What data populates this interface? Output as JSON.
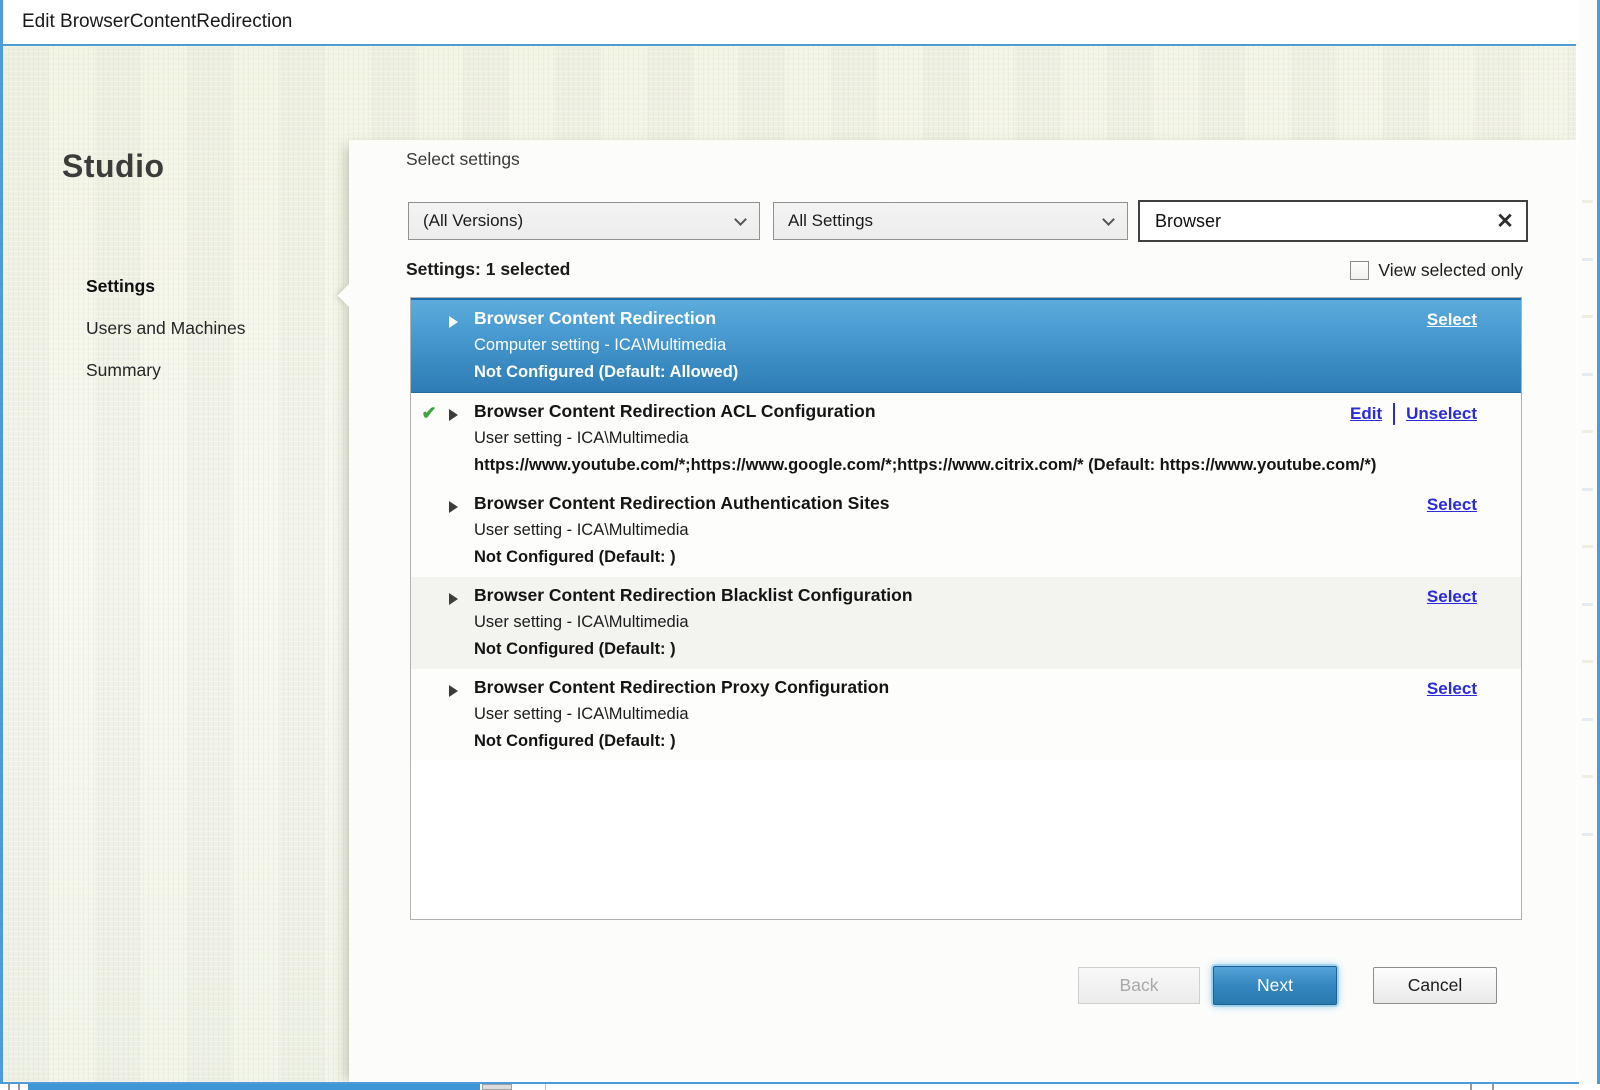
{
  "window": {
    "title": "Edit BrowserContentRedirection"
  },
  "sidebar": {
    "brand": "Studio",
    "items": [
      {
        "label": "Settings",
        "active": true
      },
      {
        "label": "Users and Machines",
        "active": false
      },
      {
        "label": "Summary",
        "active": false
      }
    ]
  },
  "content": {
    "heading": "Select settings",
    "filters": {
      "version_selected": "(All Versions)",
      "category_selected": "All Settings",
      "search_value": "Browser"
    },
    "status_line": "Settings: 1 selected",
    "view_selected_only_label": "View selected only",
    "view_selected_only_checked": false,
    "rows": [
      {
        "title": "Browser Content Redirection",
        "scope": "Computer setting - ICA\\Multimedia",
        "value": "Not Configured (Default: Allowed)",
        "state": "selected",
        "checked": false,
        "actions": [
          "Select"
        ]
      },
      {
        "title": "Browser Content Redirection ACL Configuration",
        "scope": "User setting - ICA\\Multimedia",
        "value": "https://www.youtube.com/*;https://www.google.com/*;https://www.citrix.com/* (Default: https://www.youtube.com/*)",
        "state": "configured",
        "checked": true,
        "actions": [
          "Edit",
          "Unselect"
        ]
      },
      {
        "title": "Browser Content Redirection Authentication Sites",
        "scope": "User setting - ICA\\Multimedia",
        "value": "Not Configured (Default: )",
        "state": "normal",
        "checked": false,
        "actions": [
          "Select"
        ]
      },
      {
        "title": "Browser Content Redirection Blacklist Configuration",
        "scope": "User setting - ICA\\Multimedia",
        "value": "Not Configured (Default: )",
        "state": "normal",
        "checked": false,
        "actions": [
          "Select"
        ]
      },
      {
        "title": "Browser Content Redirection Proxy Configuration",
        "scope": "User setting - ICA\\Multimedia",
        "value": "Not Configured (Default: )",
        "state": "normal",
        "checked": false,
        "actions": [
          "Select"
        ]
      }
    ]
  },
  "footer": {
    "back": "Back",
    "next": "Next",
    "cancel": "Cancel"
  },
  "icons": {
    "clear_search": "✕",
    "checkmark": "✔"
  },
  "colors": {
    "window_border_blue": "#4f9bd8",
    "selected_row_top": "#5cabdc",
    "selected_row_bottom": "#2e7cb5",
    "link_blue": "#2b2bd8",
    "check_green": "#3fa53f",
    "next_button_top": "#55a3d8",
    "next_button_bottom": "#2979ae"
  }
}
